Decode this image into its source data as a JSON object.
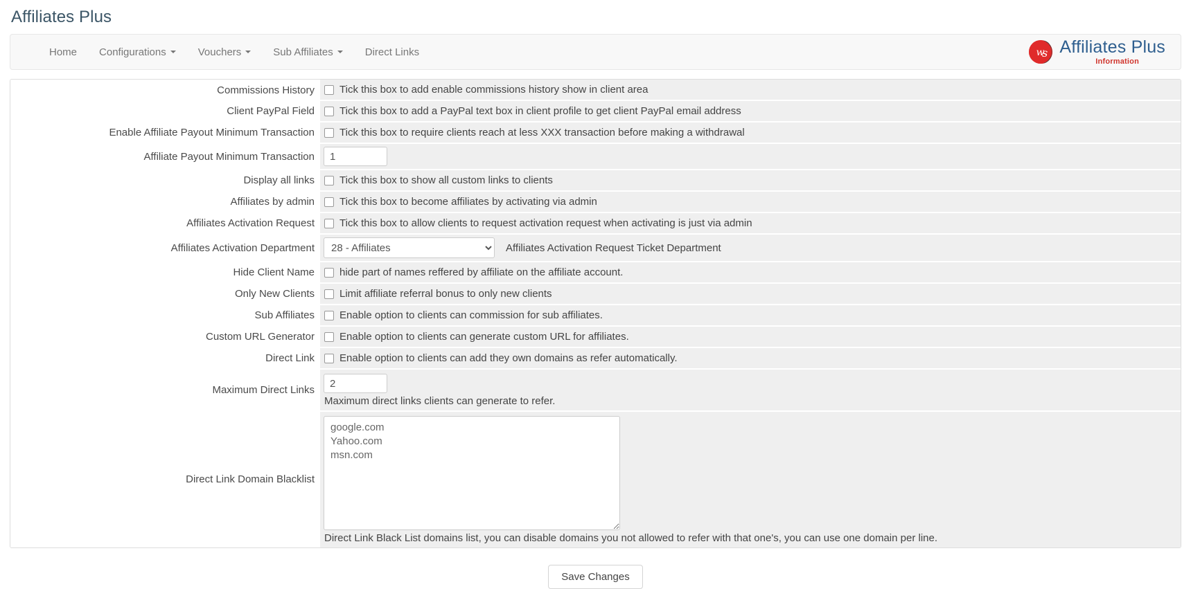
{
  "page": {
    "title": "Affiliates Plus"
  },
  "nav": {
    "items": [
      {
        "label": "Home",
        "has_caret": false
      },
      {
        "label": "Configurations",
        "has_caret": true
      },
      {
        "label": "Vouchers",
        "has_caret": true
      },
      {
        "label": "Sub Affiliates",
        "has_caret": true
      },
      {
        "label": "Direct Links",
        "has_caret": false
      }
    ]
  },
  "brand": {
    "title": "Affiliates Plus",
    "subtitle": "Information",
    "mark_colors": {
      "red": "#e02b2b",
      "dark": "#3a3a3a"
    },
    "title_color": "#2f5f8f",
    "subtitle_color": "#d0342c"
  },
  "form": {
    "rows": [
      {
        "label": "Commissions History",
        "type": "checkbox",
        "checked": false,
        "text": "Tick this box to add enable commissions history show in client area"
      },
      {
        "label": "Client PayPal Field",
        "type": "checkbox",
        "checked": false,
        "text": "Tick this box to add a PayPal text box in client profile to get client PayPal email address"
      },
      {
        "label": "Enable Affiliate Payout Minimum Transaction",
        "type": "checkbox",
        "checked": false,
        "text": "Tick this box to require clients reach at less XXX transaction before making a withdrawal"
      },
      {
        "label": "Affiliate Payout Minimum Transaction",
        "type": "text",
        "value": "1",
        "placeholder": ""
      },
      {
        "label": "Display all links",
        "type": "checkbox",
        "checked": false,
        "text": "Tick this box to show all custom links to clients"
      },
      {
        "label": "Affiliates by admin",
        "type": "checkbox",
        "checked": false,
        "text": "Tick this box to become affiliates by activating via admin"
      },
      {
        "label": "Affiliates Activation Request",
        "type": "checkbox",
        "checked": false,
        "text": "Tick this box to allow clients to request activation request when activating is just via admin"
      },
      {
        "label": "Affiliates Activation Department",
        "type": "select",
        "selected": "28 - Affiliates",
        "options": [
          "28 - Affiliates"
        ],
        "note": "Affiliates Activation Request Ticket Department"
      },
      {
        "label": "Hide Client Name",
        "type": "checkbox",
        "checked": false,
        "text": "hide part of names reffered by affiliate on the affiliate account."
      },
      {
        "label": "Only New Clients",
        "type": "checkbox",
        "checked": false,
        "text": "Limit affiliate referral bonus to only new clients"
      },
      {
        "label": "Sub Affiliates",
        "type": "checkbox",
        "checked": false,
        "text": "Enable option to clients can commission for sub affiliates."
      },
      {
        "label": "Custom URL Generator",
        "type": "checkbox",
        "checked": false,
        "text": "Enable option to clients can generate custom URL for affiliates."
      },
      {
        "label": "Direct Link",
        "type": "checkbox",
        "checked": false,
        "text": "Enable option to clients can add they own domains as refer automatically."
      },
      {
        "label": "Maximum Direct Links",
        "type": "text-with-help",
        "value": "2",
        "help": "Maximum direct links clients can generate to refer."
      },
      {
        "label": "Direct Link Domain Blacklist",
        "type": "textarea",
        "value": "google.com\nYahoo.com\nmsn.com",
        "help": "Direct Link Black List domains list, you can disable domains you not allowed to refer with that one's, you can use one domain per line."
      }
    ]
  },
  "footer": {
    "save_label": "Save Changes"
  }
}
